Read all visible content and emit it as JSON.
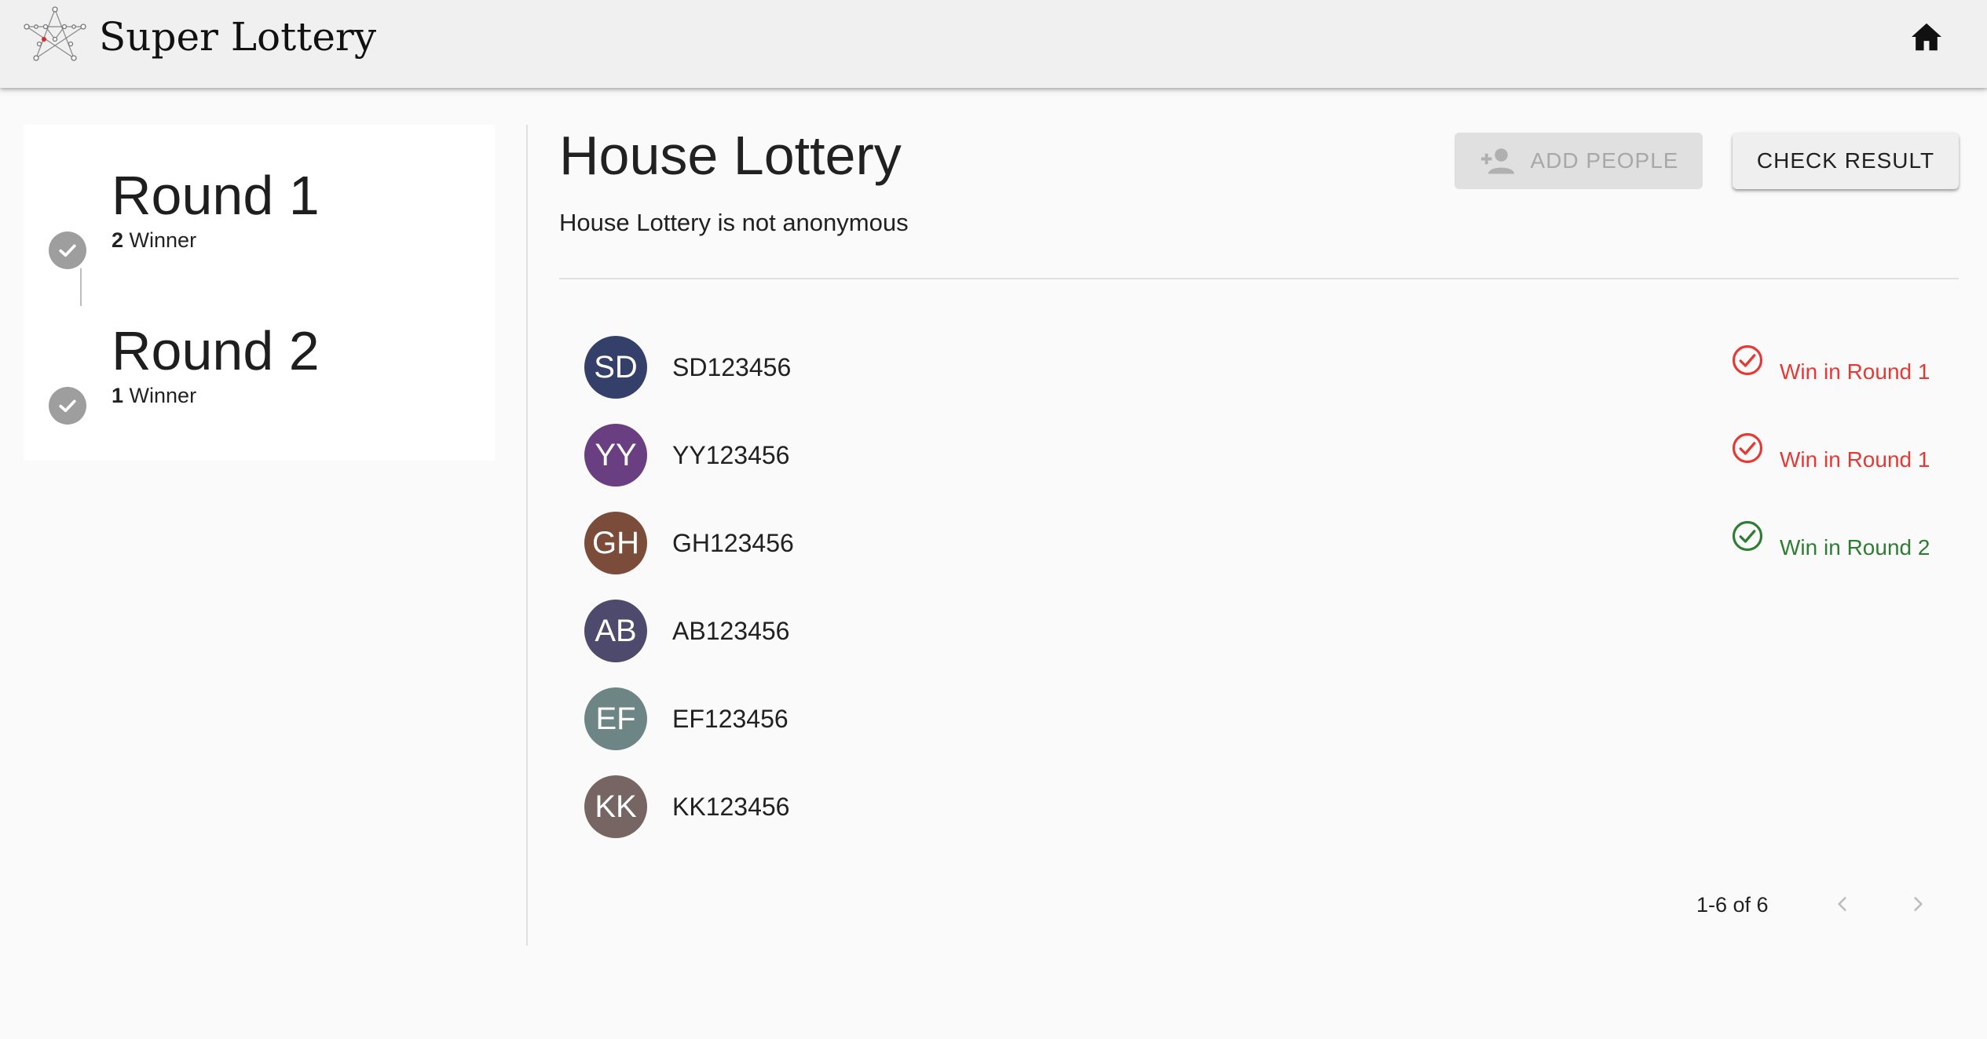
{
  "app": {
    "title": "Super Lottery",
    "logo_icon": "lottery-star-network-icon",
    "home_icon": "home-icon"
  },
  "rounds": [
    {
      "title": "Round 1",
      "count": "2",
      "suffix": "Winner",
      "icon": "check-circle-icon"
    },
    {
      "title": "Round 2",
      "count": "1",
      "suffix": "Winner",
      "icon": "check-circle-icon"
    }
  ],
  "main": {
    "title": "House Lottery",
    "subtitle": "House Lottery is not anonymous",
    "add_people_label": "ADD PEOPLE",
    "add_people_icon": "person-add-icon",
    "check_result_label": "CHECK RESULT"
  },
  "people": [
    {
      "initials": "SD",
      "id": "SD123456",
      "color": "#34406a",
      "status": "Win in Round 1",
      "status_color": "#e53935"
    },
    {
      "initials": "YY",
      "id": "YY123456",
      "color": "#6a3f82",
      "status": "Win in Round 1",
      "status_color": "#e53935"
    },
    {
      "initials": "GH",
      "id": "GH123456",
      "color": "#7a4c39",
      "status": "Win in Round 2",
      "status_color": "#2e7d32"
    },
    {
      "initials": "AB",
      "id": "AB123456",
      "color": "#4e4a6e",
      "status": "",
      "status_color": ""
    },
    {
      "initials": "EF",
      "id": "EF123456",
      "color": "#6e8585",
      "status": "",
      "status_color": ""
    },
    {
      "initials": "KK",
      "id": "KK123456",
      "color": "#776563",
      "status": "",
      "status_color": ""
    }
  ],
  "pagination": {
    "range": "1-6 of 6",
    "prev_icon": "chevron-left-icon",
    "next_icon": "chevron-right-icon"
  }
}
